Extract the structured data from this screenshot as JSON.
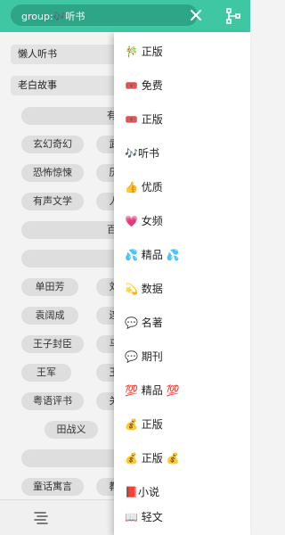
{
  "header": {
    "search_text": "group:🎶听书",
    "accent_color": "#3fc7a3",
    "clear_icon": "close-icon",
    "menu_icon": "share-nodes-icon"
  },
  "groups": [
    "懒人听书",
    "老白故事"
  ],
  "chips": {
    "wide_row_1": "有",
    "row_a": [
      "玄幻奇幻",
      "武"
    ],
    "row_b": [
      "恐怖惊悚",
      "历"
    ],
    "row_c": [
      "有声文学",
      "人"
    ],
    "wide_row_2": "百",
    "wide_row_3": "",
    "row_d": [
      "单田芳",
      "刘"
    ],
    "row_e": [
      "袁阔成",
      "连"
    ],
    "row_f": [
      "王子封臣",
      "马"
    ],
    "row_g": [
      "王军",
      "王"
    ],
    "row_h": [
      "粤语评书",
      "关"
    ],
    "row_i": "田战义",
    "wide_row_4": "",
    "row_j": [
      "童话寓言",
      "教"
    ]
  },
  "bottombar": {
    "icon": "layers-icon"
  },
  "menu": {
    "items": [
      "🎋 正版",
      "🎟️ 免费",
      "🎟️ 正版",
      "🎶听书",
      "👍 优质",
      "💗 女频",
      "💦 精品 💦",
      "💫 数据",
      "💬 名著",
      "💬 期刊",
      "💯 精品 💯",
      "💰 正版",
      "💰 正版 💰",
      "📕小说",
      "📖 轻文"
    ]
  }
}
